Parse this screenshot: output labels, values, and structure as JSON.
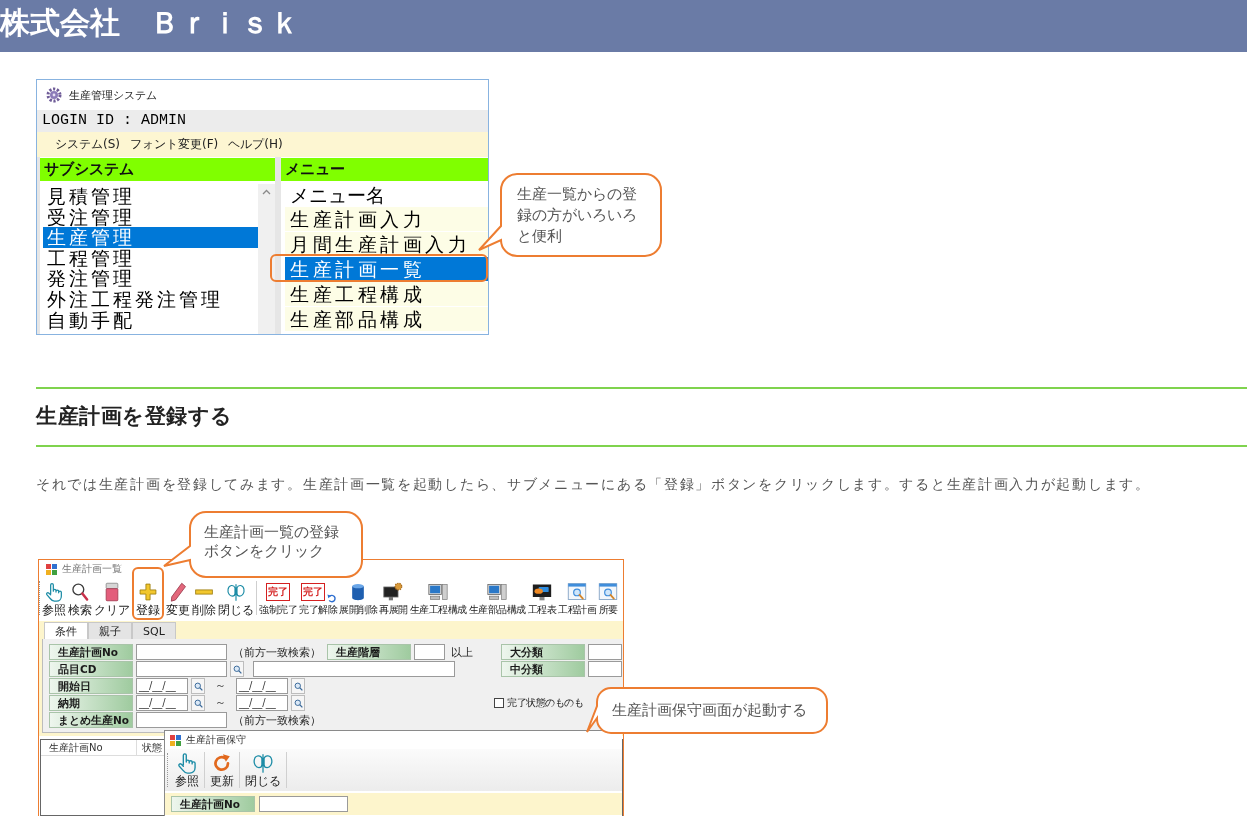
{
  "header": {
    "title": "株式会社　Ｂｒｉｓｋ"
  },
  "figure_1": {
    "window_title": "生産管理システム",
    "login": "LOGIN ID : ADMIN",
    "menus": [
      "システム(S)",
      "フォント変更(F)",
      "ヘルプ(H)"
    ],
    "subsystems": {
      "title": "サブシステム",
      "items": [
        {
          "label": "見積管理",
          "selected": false
        },
        {
          "label": "受注管理",
          "selected": false
        },
        {
          "label": "生産管理",
          "selected": true
        },
        {
          "label": "工程管理",
          "selected": false
        },
        {
          "label": "発注管理",
          "selected": false
        },
        {
          "label": "外注工程発注管理",
          "selected": false
        },
        {
          "label": "自動手配",
          "selected": false
        }
      ]
    },
    "menu": {
      "title": "メニュー",
      "column": "メニュー名",
      "items": [
        {
          "label": "生産計画入力",
          "selected": false,
          "highlighted": false
        },
        {
          "label": "月間生産計画入力",
          "selected": false,
          "highlighted": false
        },
        {
          "label": "生産計画一覧",
          "selected": true,
          "highlighted": true
        },
        {
          "label": "生産工程構成",
          "selected": false,
          "highlighted": false
        },
        {
          "label": "生産部品構成",
          "selected": false,
          "highlighted": false
        }
      ]
    },
    "callout": "生産一覧からの登録の方がいろいろと便利"
  },
  "section": {
    "heading": "生産計画を登録する",
    "text": "それでは生産計画を登録してみます。生産計画一覧を起動したら、サブメニューにある「登録」ボタンをクリックします。すると生産計画入力が起動します。"
  },
  "figure_2": {
    "window_title": "生産計画一覧",
    "toolbar": [
      {
        "items": [
          {
            "label": "参照",
            "kind": "hand",
            "highlighted": false
          },
          {
            "label": "検索",
            "kind": "magnifier",
            "highlighted": false
          },
          {
            "label": "クリア",
            "kind": "eraser",
            "highlighted": false
          },
          {
            "label": "登録",
            "kind": "plus",
            "highlighted": true
          },
          {
            "label": "変更",
            "kind": "pencil",
            "highlighted": false
          },
          {
            "label": "削除",
            "kind": "minus",
            "highlighted": false
          },
          {
            "label": "閉じる",
            "kind": "binoculars",
            "highlighted": false
          }
        ]
      },
      {
        "items": [
          {
            "label": "強制完了",
            "kind": "stamp",
            "stamp": "完了",
            "highlighted": false
          },
          {
            "label": "完了解除",
            "kind": "stamp_undo",
            "stamp": "完了",
            "highlighted": false
          },
          {
            "label": "展開削除",
            "kind": "cylinder",
            "highlighted": false
          },
          {
            "label": "再展開",
            "kind": "monitor_gear",
            "highlighted": false
          },
          {
            "label": "生産工程構成",
            "kind": "computer",
            "highlighted": false
          },
          {
            "label": "生産部品構成",
            "kind": "computer",
            "highlighted": false
          },
          {
            "label": "工程表",
            "kind": "monitor_chart",
            "highlighted": false
          },
          {
            "label": "工程計画",
            "kind": "window_search",
            "highlighted": false
          },
          {
            "label": "所要",
            "kind": "window_search",
            "highlighted": false
          }
        ]
      }
    ],
    "tabs": [
      {
        "label": "条件",
        "selected": true
      },
      {
        "label": "親子",
        "selected": false
      },
      {
        "label": "SQL",
        "selected": false
      }
    ],
    "form": {
      "plan_no": {
        "label": "生産計画No",
        "note": "（前方一致検索）"
      },
      "level": {
        "label": "生産階層",
        "note": "以上"
      },
      "major_class": {
        "label": "大分類"
      },
      "item_cd": {
        "label": "品目CD"
      },
      "middle_class": {
        "label": "中分類"
      },
      "start_date": {
        "label": "開始日",
        "from": "__/__/__",
        "separator": "～",
        "to": "__/__/__"
      },
      "due_date": {
        "label": "納期",
        "from": "__/__/__",
        "separator": "～",
        "to": "__/__/__"
      },
      "include_completed": {
        "label": "完了状態のものも",
        "checked": false
      },
      "batch_no": {
        "label": "まとめ生産No",
        "note": "（前方一致検索）"
      }
    },
    "list": {
      "columns": [
        "生産計画No",
        "状態"
      ]
    },
    "child_window": {
      "title": "生産計画保守",
      "toolbar": [
        {
          "label": "参照",
          "kind": "hand"
        },
        {
          "label": "更新",
          "kind": "refresh"
        },
        {
          "label": "閉じる",
          "kind": "binoculars"
        }
      ],
      "field": {
        "label": "生産計画No"
      }
    },
    "callouts": [
      "生産計画一覧の登録ボタンをクリック",
      "生産計画保守画面が起動する"
    ]
  }
}
